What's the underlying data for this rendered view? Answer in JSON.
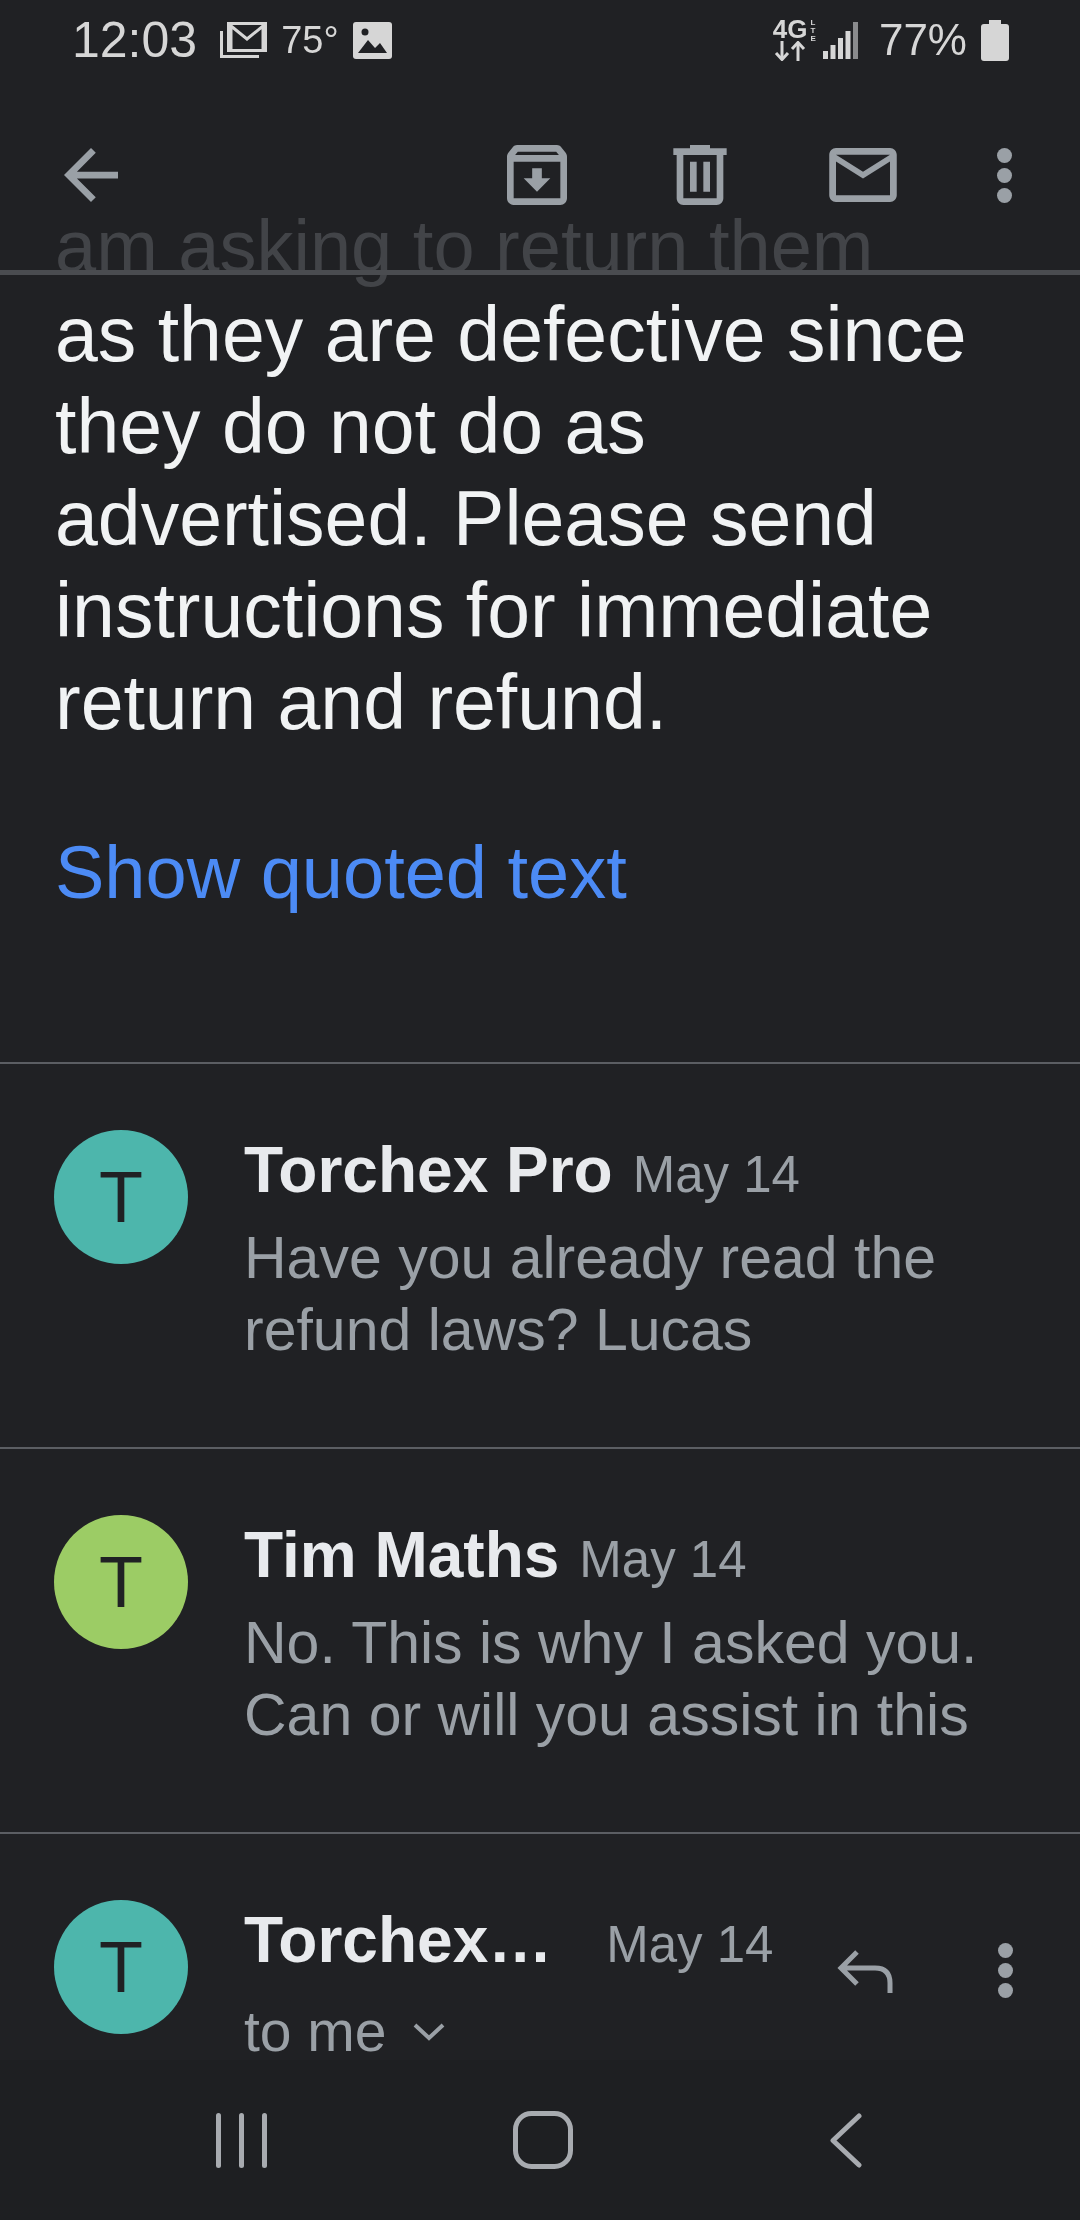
{
  "status_bar": {
    "time": "12:03",
    "temperature": "75°",
    "network": "4G",
    "network_detail": "LTE",
    "battery": "77%"
  },
  "message": {
    "text_under_toolbar": "am asking to return them",
    "text": "as they are defective since they do not do as advertised. Please send instructions for immediate return and refund.",
    "quoted_text_link": "Show quoted text"
  },
  "thread": [
    {
      "kind": "collapsed",
      "initial": "T",
      "color": "#4db6ac",
      "sender": "Torchex Pro",
      "date": "May 14",
      "snippet": "Have you already read the refund laws? Lucas"
    },
    {
      "kind": "collapsed",
      "initial": "T",
      "color": "#9ccc65",
      "sender": "Tim Maths",
      "date": "May 14",
      "snippet": "No. This is why I asked you. Can or will you assist in this"
    },
    {
      "kind": "expanded",
      "initial": "T",
      "color": "#4db6ac",
      "sender": "Torchex…",
      "date": "May 14",
      "recipients": "to me"
    }
  ]
}
